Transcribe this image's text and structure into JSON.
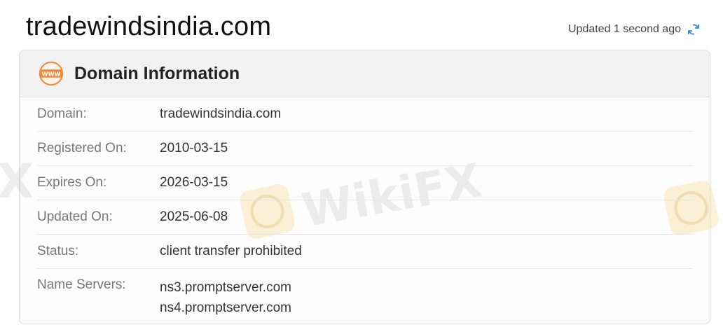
{
  "page_title": "tradewindsindia.com",
  "updated_text": "Updated 1 second ago",
  "card": {
    "title": "Domain Information",
    "icon": "www-icon"
  },
  "rows": [
    {
      "label": "Domain:",
      "value": "tradewindsindia.com"
    },
    {
      "label": "Registered On:",
      "value": "2010-03-15"
    },
    {
      "label": "Expires On:",
      "value": "2026-03-15"
    },
    {
      "label": "Updated On:",
      "value": "2025-06-08"
    },
    {
      "label": "Status:",
      "value": "client transfer prohibited"
    }
  ],
  "name_servers": {
    "label": "Name Servers:",
    "values": [
      "ns3.promptserver.com",
      "ns4.promptserver.com"
    ]
  },
  "watermark": "WikiFX",
  "colors": {
    "accent_orange": "#f08a3c",
    "refresh_blue": "#3a8ee6"
  }
}
